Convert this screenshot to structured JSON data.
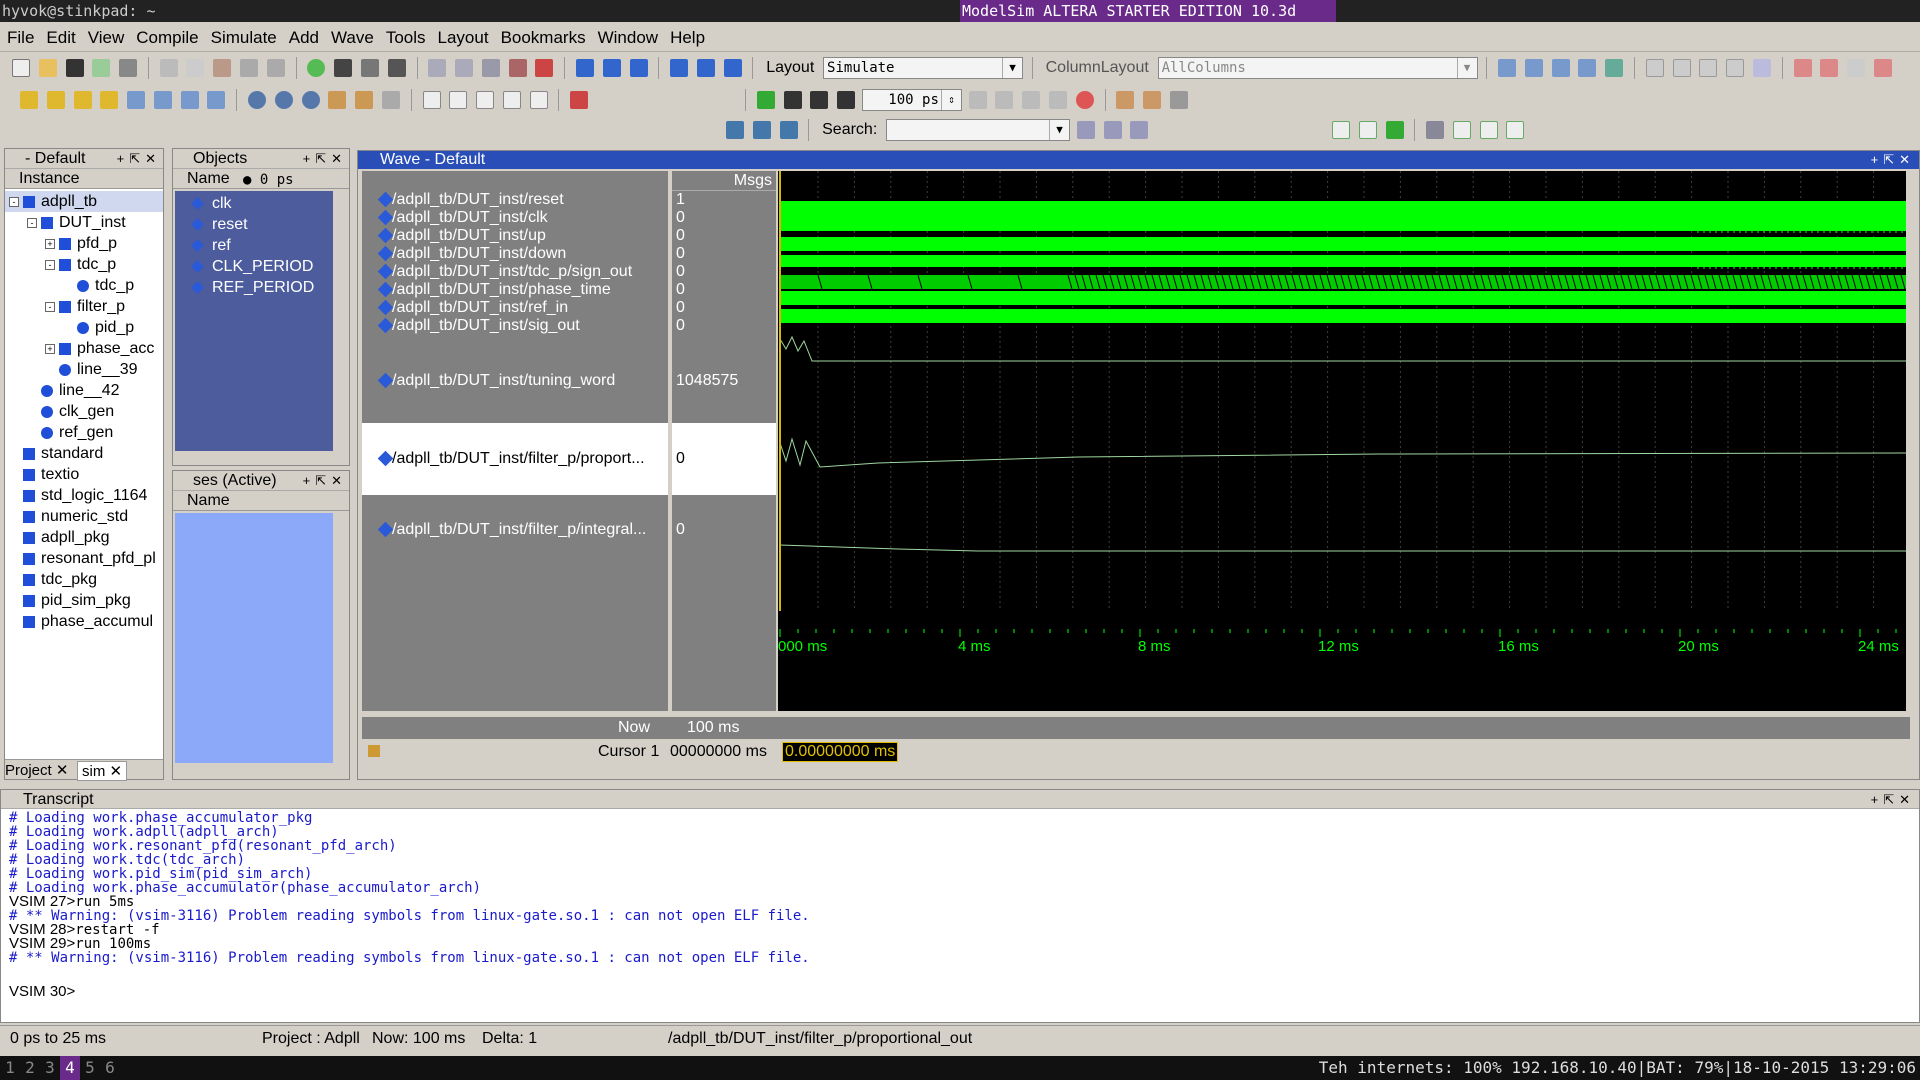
{
  "topbar": {
    "user_host": "hyvok@stinkpad: ~",
    "window_title": "ModelSim ALTERA STARTER EDITION 10.3d"
  },
  "menu": [
    "File",
    "Edit",
    "View",
    "Compile",
    "Simulate",
    "Add",
    "Wave",
    "Tools",
    "Layout",
    "Bookmarks",
    "Window",
    "Help"
  ],
  "toolbar": {
    "layout_label": "Layout",
    "layout_value": "Simulate",
    "column_layout_label": "ColumnLayout",
    "column_layout_value": "AllColumns",
    "run_length": "100 ps",
    "search_label": "Search:",
    "search_value": ""
  },
  "instance_panel": {
    "title": "- Default",
    "column": "Instance",
    "items": [
      {
        "label": "adpll_tb",
        "depth": 0,
        "kind": "square",
        "exp": "-"
      },
      {
        "label": "DUT_inst",
        "depth": 1,
        "kind": "square",
        "exp": "-"
      },
      {
        "label": "pfd_p",
        "depth": 2,
        "kind": "square",
        "exp": "+"
      },
      {
        "label": "tdc_p",
        "depth": 2,
        "kind": "square",
        "exp": "-"
      },
      {
        "label": "tdc_p",
        "depth": 3,
        "kind": "dot",
        "exp": ""
      },
      {
        "label": "filter_p",
        "depth": 2,
        "kind": "square",
        "exp": "-"
      },
      {
        "label": "pid_p",
        "depth": 3,
        "kind": "dot",
        "exp": ""
      },
      {
        "label": "phase_acc",
        "depth": 2,
        "kind": "square",
        "exp": "+"
      },
      {
        "label": "line__39",
        "depth": 2,
        "kind": "dot",
        "exp": ""
      },
      {
        "label": "line__42",
        "depth": 1,
        "kind": "dot",
        "exp": ""
      },
      {
        "label": "clk_gen",
        "depth": 1,
        "kind": "dot",
        "exp": ""
      },
      {
        "label": "ref_gen",
        "depth": 1,
        "kind": "dot",
        "exp": ""
      },
      {
        "label": "standard",
        "depth": 0,
        "kind": "square",
        "exp": ""
      },
      {
        "label": "textio",
        "depth": 0,
        "kind": "square",
        "exp": ""
      },
      {
        "label": "std_logic_1164",
        "depth": 0,
        "kind": "square",
        "exp": ""
      },
      {
        "label": "numeric_std",
        "depth": 0,
        "kind": "square",
        "exp": ""
      },
      {
        "label": "adpll_pkg",
        "depth": 0,
        "kind": "square",
        "exp": ""
      },
      {
        "label": "resonant_pfd_pl",
        "depth": 0,
        "kind": "square",
        "exp": ""
      },
      {
        "label": "tdc_pkg",
        "depth": 0,
        "kind": "square",
        "exp": ""
      },
      {
        "label": "pid_sim_pkg",
        "depth": 0,
        "kind": "square",
        "exp": ""
      },
      {
        "label": "phase_accumul",
        "depth": 0,
        "kind": "square",
        "exp": ""
      }
    ],
    "tabs": [
      "Project",
      "sim"
    ]
  },
  "objects_panel": {
    "title": "Objects",
    "column": "Name",
    "time": "0 ps",
    "items": [
      "clk",
      "reset",
      "ref",
      "CLK_PERIOD",
      "REF_PERIOD"
    ]
  },
  "processes_panel": {
    "title": "ses (Active)",
    "column": "Name"
  },
  "wave": {
    "title": "Wave - Default",
    "msgs_header": "Msgs",
    "signals": [
      {
        "name": "/adpll_tb/DUT_inst/reset",
        "value": "1"
      },
      {
        "name": "/adpll_tb/DUT_inst/clk",
        "value": "0"
      },
      {
        "name": "/adpll_tb/DUT_inst/up",
        "value": "0"
      },
      {
        "name": "/adpll_tb/DUT_inst/down",
        "value": "0"
      },
      {
        "name": "/adpll_tb/DUT_inst/tdc_p/sign_out",
        "value": "0"
      },
      {
        "name": "/adpll_tb/DUT_inst/phase_time",
        "value": "0"
      },
      {
        "name": "/adpll_tb/DUT_inst/ref_in",
        "value": "0"
      },
      {
        "name": "/adpll_tb/DUT_inst/sig_out",
        "value": "0"
      },
      {
        "name": "/adpll_tb/DUT_inst/tuning_word",
        "value": "1048575"
      },
      {
        "name": "/adpll_tb/DUT_inst/filter_p/proport...",
        "value": "0"
      },
      {
        "name": "/adpll_tb/DUT_inst/filter_p/integral...",
        "value": "0"
      }
    ],
    "now_label": "Now",
    "now_value": "100 ms",
    "cursor_label": "Cursor 1",
    "cursor_value": "00000000 ms",
    "cursor_time": "0.00000000 ms",
    "ruler": [
      "000 ms",
      "4 ms",
      "8 ms",
      "12 ms",
      "16 ms",
      "20 ms",
      "24 ms"
    ]
  },
  "transcript": {
    "title": "Transcript",
    "lines": [
      {
        "text": "# Loading work.phase_accumulator_pkg",
        "kind": "msg"
      },
      {
        "text": "# Loading work.adpll(adpll_arch)",
        "kind": "msg"
      },
      {
        "text": "# Loading work.resonant_pfd(resonant_pfd_arch)",
        "kind": "msg"
      },
      {
        "text": "# Loading work.tdc(tdc_arch)",
        "kind": "msg"
      },
      {
        "text": "# Loading work.pid_sim(pid_sim_arch)",
        "kind": "msg"
      },
      {
        "text": "# Loading work.phase_accumulator(phase_accumulator_arch)",
        "kind": "msg"
      },
      {
        "text": "run 5ms",
        "kind": "cmd",
        "prompt": "VSIM 27>"
      },
      {
        "text": "# ** Warning: (vsim-3116) Problem reading symbols from linux-gate.so.1 : can not open ELF file.",
        "kind": "msg"
      },
      {
        "text": "restart -f",
        "kind": "cmd",
        "prompt": "VSIM 28>"
      },
      {
        "text": "run 100ms",
        "kind": "cmd",
        "prompt": "VSIM 29>"
      },
      {
        "text": "# ** Warning: (vsim-3116) Problem reading symbols from linux-gate.so.1 : can not open ELF file.",
        "kind": "msg"
      },
      {
        "text": "",
        "kind": "blank"
      },
      {
        "text": "",
        "kind": "cmd",
        "prompt": "VSIM 30>"
      }
    ]
  },
  "status": {
    "range": "0 ps to 25 ms",
    "project": "Project : Adpll",
    "now": "Now: 100 ms",
    "delta": "Delta: 1",
    "path": "/adpll_tb/DUT_inst/filter_p/proportional_out"
  },
  "bottombar": {
    "workspaces": [
      "1",
      "2",
      "3",
      "4",
      "5",
      "6"
    ],
    "active_workspace": "4",
    "sysinfo": "Teh internets: 100% 192.168.10.40|BAT: 79%|18-10-2015 13:29:06"
  },
  "colors": {
    "wave_green": "#00ff00",
    "wave_line": "#9fd89f",
    "cursor": "#d4b800",
    "wave_bg": "#000000"
  }
}
